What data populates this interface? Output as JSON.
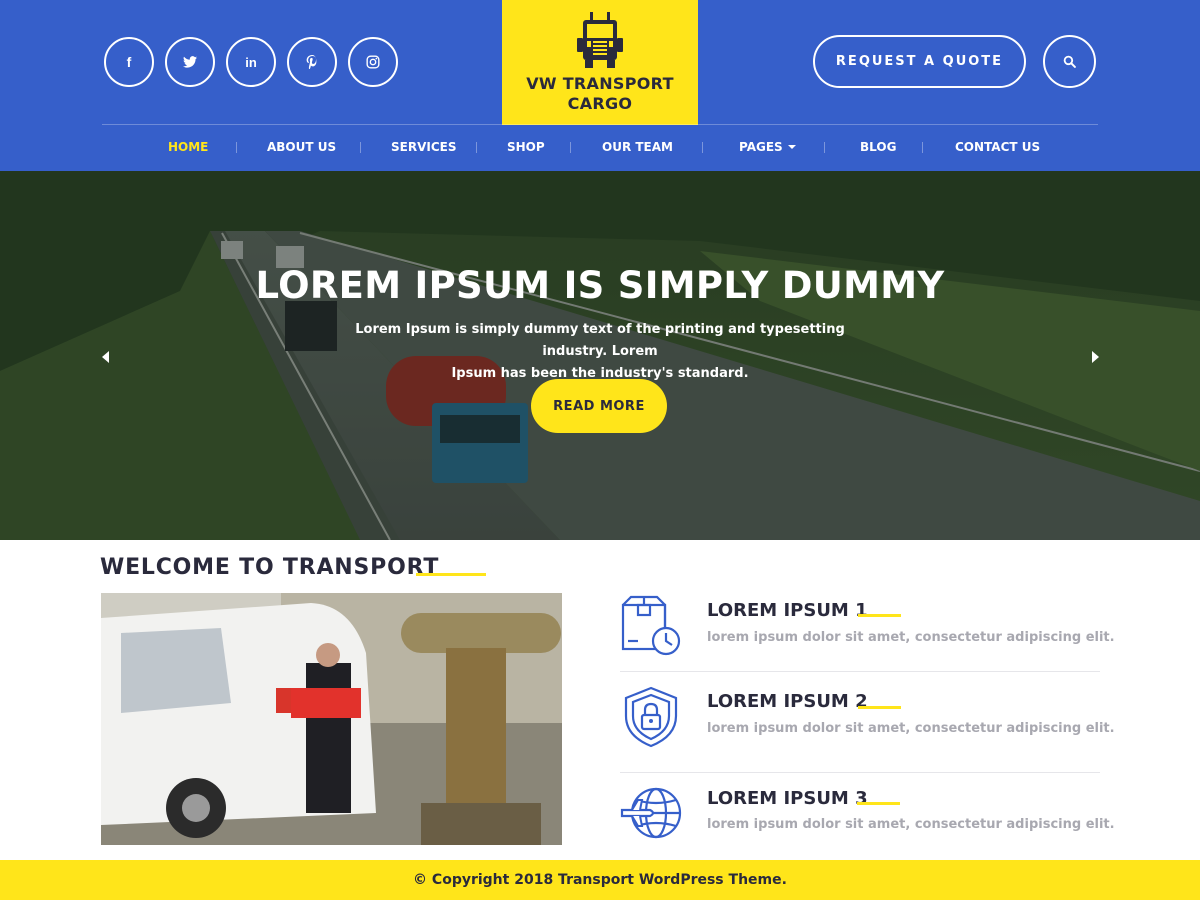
{
  "header": {
    "social": [
      {
        "icon": "facebook-icon",
        "glyph": "f"
      },
      {
        "icon": "twitter-icon",
        "glyph": ""
      },
      {
        "icon": "linkedin-icon",
        "glyph": "in"
      },
      {
        "icon": "pinterest-icon",
        "glyph": ""
      },
      {
        "icon": "instagram-icon",
        "glyph": ""
      }
    ],
    "logo": {
      "line1": "VW TRANSPORT",
      "line2": "CARGO"
    },
    "quote_label": "REQUEST A QUOTE",
    "nav": [
      {
        "label": "HOME",
        "active": true
      },
      {
        "label": "ABOUT US",
        "active": false
      },
      {
        "label": "SERVICES",
        "active": false
      },
      {
        "label": "SHOP",
        "active": false
      },
      {
        "label": "OUR TEAM",
        "active": false
      },
      {
        "label": "PAGES",
        "active": false,
        "has_dropdown": true
      },
      {
        "label": "BLOG",
        "active": false
      },
      {
        "label": "CONTACT US",
        "active": false
      }
    ]
  },
  "hero": {
    "title": "LOREM IPSUM IS SIMPLY DUMMY",
    "subtitle_line1": "Lorem Ipsum is simply dummy text of the printing and typesetting industry. Lorem",
    "subtitle_line2": "Ipsum has been the industry's standard.",
    "button": "READ MORE"
  },
  "welcome": {
    "title": "WELCOME TO TRANSPORT",
    "features": [
      {
        "icon": "package-clock-icon",
        "title": "LOREM IPSUM 1",
        "text": "lorem ipsum dolor sit amet, consectetur adipiscing elit."
      },
      {
        "icon": "shield-lock-icon",
        "title": "LOREM IPSUM 2",
        "text": "lorem ipsum dolor sit amet, consectetur adipiscing elit."
      },
      {
        "icon": "globe-plane-icon",
        "title": "LOREM IPSUM 3",
        "text": "lorem ipsum dolor sit amet, consectetur adipiscing elit."
      }
    ]
  },
  "footer": {
    "copyright": "© Copyright 2018 Transport WordPress Theme."
  },
  "colors": {
    "primary_blue": "#365fca",
    "accent_yellow": "#ffe51a",
    "dark_text": "#2a2a3c",
    "muted_text": "#a8a8b0"
  }
}
